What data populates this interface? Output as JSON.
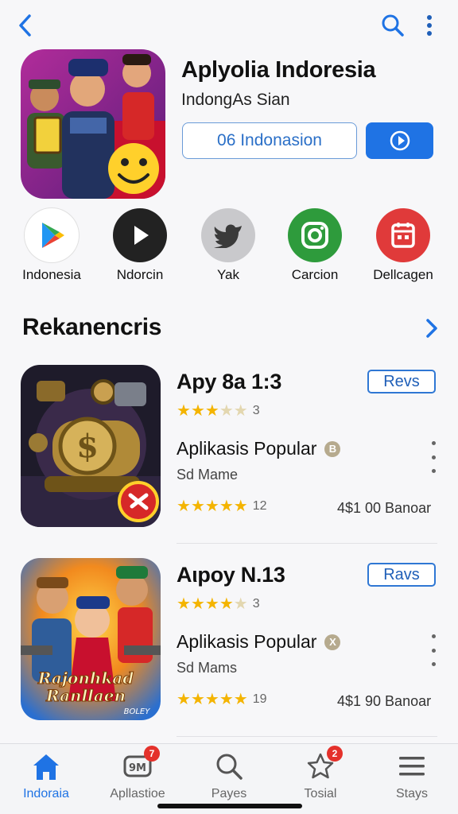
{
  "header": {
    "back_icon": "chevron-left-icon",
    "search_icon": "search-icon",
    "more_icon": "more-vertical-icon"
  },
  "app": {
    "title": "Aplyolia Indoresia",
    "subtitle": "IndongAs Sian",
    "primary_button": "06 Indonasion",
    "secondary_button_icon": "clock-play-icon"
  },
  "share_targets": [
    {
      "label": "Indonesia",
      "icon": "play-store-icon",
      "color": "#ffffff"
    },
    {
      "label": "Ndorcin",
      "icon": "play-icon",
      "color": "#222222"
    },
    {
      "label": "Yak",
      "icon": "bird-icon",
      "color": "#c9c9cc"
    },
    {
      "label": "Carcion",
      "icon": "camera-icon",
      "color": "#2e9b3c"
    },
    {
      "label": "Dellcagen",
      "icon": "calendar-icon",
      "color": "#e03a3a"
    }
  ],
  "section": {
    "title": "Rekanencris",
    "arrow_icon": "chevron-right-icon"
  },
  "apps": [
    {
      "name": "Apy 8a 1:3",
      "tag": "Revs",
      "rating_stars": 3,
      "rating_count": "3",
      "category": "Aplikasis Popular",
      "category_badge": "B",
      "developer": "Sd Mame",
      "rating2_stars": 5,
      "rating2_count": "12",
      "price": "4$1 00 Banoar"
    },
    {
      "name": "Aιpoy N.13",
      "tag": "Ravs",
      "rating_stars": 4,
      "rating_count": "3",
      "category": "Aplikasis Popular",
      "category_badge": "X",
      "developer": "Sd Mams",
      "rating2_stars": 5,
      "rating2_count": "19",
      "price": "4$1 90 Banoar",
      "thumb_text_1": "Rajonhkad",
      "thumb_text_2": "Ranllaen",
      "thumb_text_3": "BOLEY"
    }
  ],
  "bottom_nav": [
    {
      "label": "Indoraia",
      "icon": "home-icon",
      "active": true,
      "badge": ""
    },
    {
      "label": "Apllastioe",
      "icon": "apps-icon",
      "active": false,
      "badge": "7"
    },
    {
      "label": "Payes",
      "icon": "search-icon",
      "active": false,
      "badge": ""
    },
    {
      "label": "Tosial",
      "icon": "star-icon",
      "active": false,
      "badge": "2"
    },
    {
      "label": "Stays",
      "icon": "menu-icon",
      "active": false,
      "badge": ""
    }
  ],
  "colors": {
    "accent": "#1f73e4",
    "star": "#f4b400"
  }
}
